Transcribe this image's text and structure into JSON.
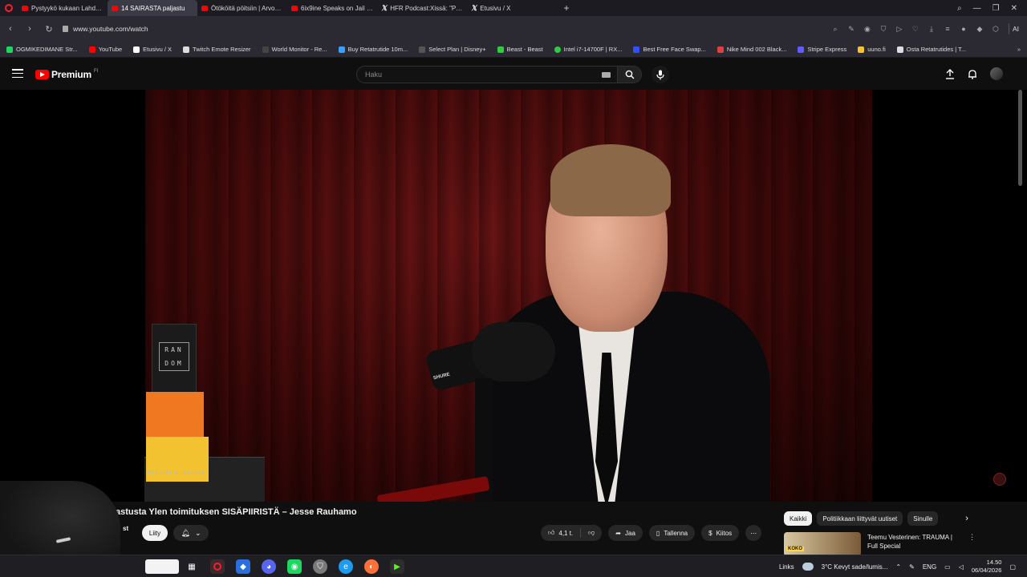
{
  "browser": {
    "tabs": [
      {
        "label": "Pystyykö kukaan Lahdessa",
        "icon": "youtube-icon",
        "active": false
      },
      {
        "label": "14 SAIRASTA paljastu",
        "icon": "youtube-icon",
        "active": true
      },
      {
        "label": "Ötököitä pöitsiin | Arvosta",
        "icon": "youtube-icon",
        "active": false
      },
      {
        "label": "6ix9ine Speaks on Jail with",
        "icon": "youtube-icon",
        "active": false
      },
      {
        "label": "HFR Podcast:Xissä: \"Pepsi",
        "icon": "x-icon",
        "active": false
      },
      {
        "label": "Etusivu / X",
        "icon": "x-icon",
        "active": false
      }
    ],
    "url": "www.youtube.com/watch",
    "ai_label": "AI",
    "bookmarks": [
      {
        "label": "OGMIKEDIMANE Str...",
        "color": "#1ed760"
      },
      {
        "label": "YouTube",
        "color": "#ff0000"
      },
      {
        "label": "Etusivu / X",
        "color": "#ffffff"
      },
      {
        "label": "Twitch Emote Resizer",
        "color": "#dddddd"
      },
      {
        "label": "World Monitor - Re...",
        "color": "#444444"
      },
      {
        "label": "Buy Retatrutide 10m...",
        "color": "#3aa0ff"
      },
      {
        "label": "Select Plan | Disney+",
        "color": "#555555"
      },
      {
        "label": "Beast - Beast",
        "color": "#2ecc40"
      },
      {
        "label": "Intel i7-14700F | RX...",
        "color": "#2ecc40"
      },
      {
        "label": "Best Free Face Swap...",
        "color": "#3050ff"
      },
      {
        "label": "Nike Mind 002 Black...",
        "color": "#e04040"
      },
      {
        "label": "Stripe Express",
        "color": "#635bff"
      },
      {
        "label": "uuno.fi",
        "color": "#f2c230"
      },
      {
        "label": "Osta Retatrutides | T...",
        "color": "#dddddd"
      }
    ]
  },
  "youtube": {
    "logo_word": "Premium",
    "logo_region": "FI",
    "search_placeholder": "Haku",
    "video": {
      "title": "astusta Ylen toimituksen SISÄPIIRISTÄ – Jesse Rauhamo",
      "channel_fragment": "st",
      "subscribe_label": "Liity",
      "likes": "4,1 t.",
      "share_label": "Jaa",
      "save_label": "Tallenna",
      "thanks_label": "Kiitos",
      "mic_brand": "SHURE",
      "prop_box_text": "RAN DOM",
      "books_text": "ATEISMIN HARHAT"
    },
    "chips": [
      "Kaikki",
      "Politiikkaan liittyvät uutiset",
      "Sinulle"
    ],
    "recommended": {
      "title": "Teemu Vesterinen: TRAUMA | Full Special",
      "thumb_text": "KOKO"
    }
  },
  "taskbar": {
    "links_label": "Links",
    "weather": "3°C  Kevyt sade/lumis...",
    "lang": "ENG",
    "time": "14.50",
    "date": "06/04/2026"
  }
}
